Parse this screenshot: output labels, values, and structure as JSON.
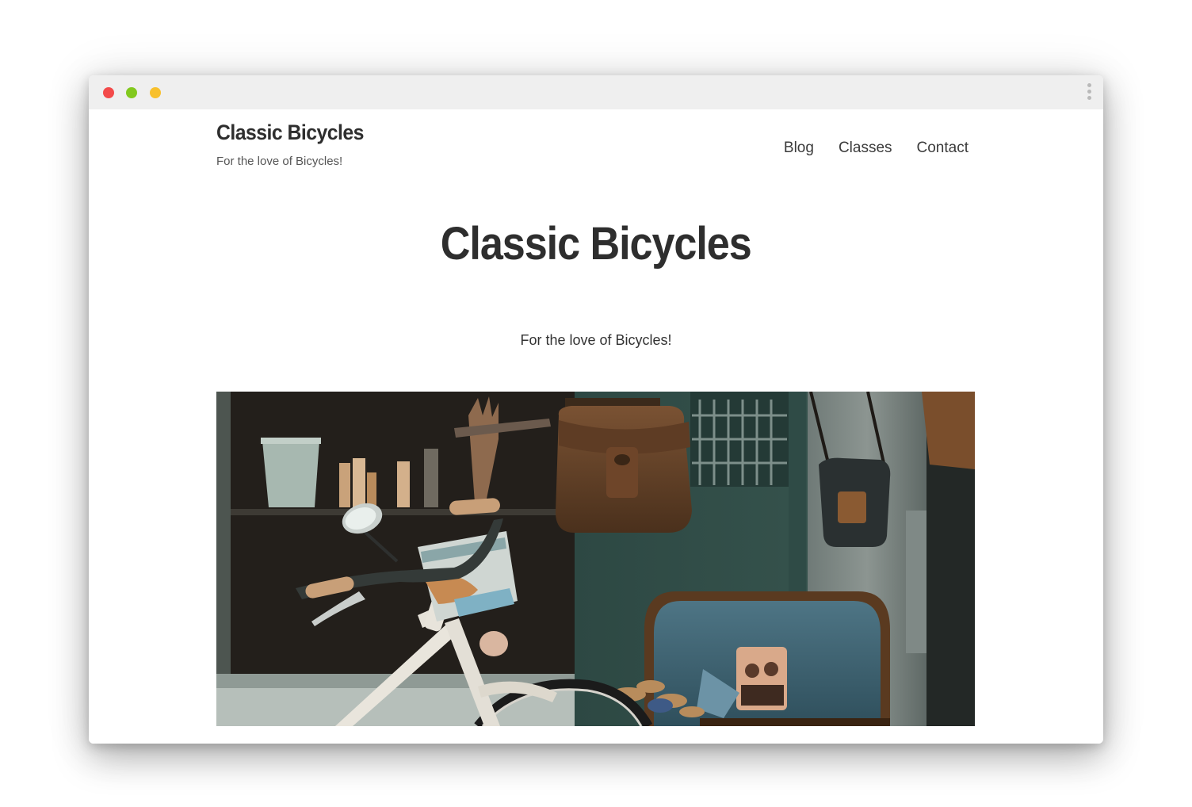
{
  "window": {
    "controls": [
      "close",
      "minimize",
      "maximize"
    ],
    "control_colors": {
      "close": "#f34a4a",
      "minimize": "#82c91e",
      "maximize": "#f8c02c"
    },
    "menu_icon": "kebab-menu-icon"
  },
  "header": {
    "site_title": "Classic Bicycles",
    "tagline": "For the love of Bicycles!",
    "nav": [
      {
        "label": "Blog"
      },
      {
        "label": "Classes"
      },
      {
        "label": "Contact"
      }
    ]
  },
  "hero": {
    "title": "Classic Bicycles",
    "tagline": "For the love of Bicycles!"
  },
  "colors": {
    "text_dark": "#2e2e2e",
    "titlebar": "#efefef"
  }
}
